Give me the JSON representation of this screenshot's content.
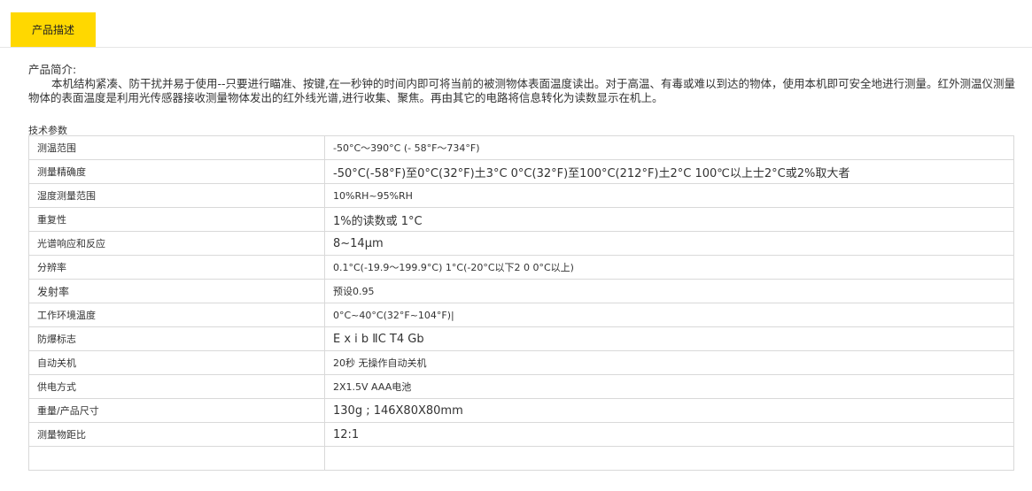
{
  "tabs": [
    {
      "label": "产品描述",
      "active": true
    }
  ],
  "intro": {
    "title": "产品简介:",
    "text": "本机结构紧凑、防干扰并易于使用--只要进行瞄准、按键,在一秒钟的时间内即可将当前的被测物体表面温度读出。对于高温、有毒或难以到达的物体，使用本机即可安全地进行测量。红外测温仪测量物体的表面温度是利用光传感器接收测量物体发出的红外线光谱,进行收集、聚焦。再由其它的电路将信息转化为读数显示在机上。"
  },
  "specs": {
    "caption": "技术参数",
    "rows": [
      {
        "label": "测温范围",
        "value": "-50°C～390°C  (- 58°F～734°F)"
      },
      {
        "label": "测量精确度",
        "value": "-50°C(-58°F)至0°C(32°F)土3°C 0°C(32°F)至100°C(212°F)土2°C 100℃以上士2°C或2%取大者"
      },
      {
        "label": "湿度测量范围",
        "value": "10%RH~95%RH"
      },
      {
        "label": "重复性",
        "value": "1%的读数或 1°C"
      },
      {
        "label": "光谱响应和反应",
        "value": "8~14μm"
      },
      {
        "label": "分辨率",
        "value": "0.1°C(-19.9～199.9°C)   1°C(-20°C以下2 0 0°C以上)"
      },
      {
        "label": "发射率",
        "value": "预设0.95"
      },
      {
        "label": "工作环境温度",
        "value": "0°C~40°C(32°F~104°F)|"
      },
      {
        "label": "防爆标志",
        "value": "E x i b ⅡC T4 Gb"
      },
      {
        "label": "自动关机",
        "value": "20秒 无操作自动关机"
      },
      {
        "label": "供电方式",
        "value": "2X1.5V AAA电池"
      },
      {
        "label": "重量/产品尺寸",
        "value": "130g ; 146X80X80mm"
      },
      {
        "label": "测量物距比",
        "value": "12:1"
      },
      {
        "label": "",
        "value": ""
      }
    ]
  }
}
